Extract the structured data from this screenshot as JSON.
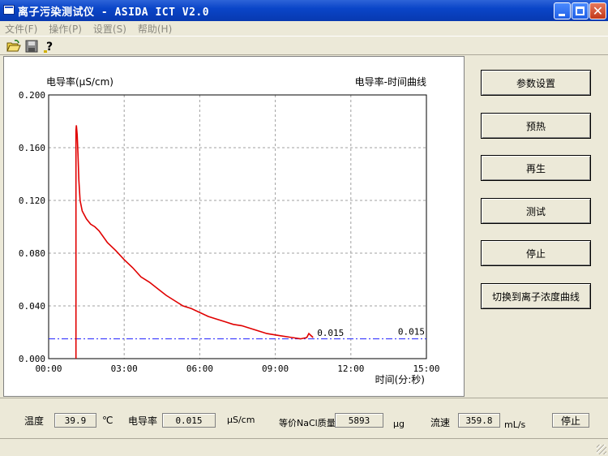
{
  "window": {
    "title": "离子污染测试仪 - ASIDA ICT V2.0"
  },
  "menu": [
    "文件(F)",
    "操作(P)",
    "设置(S)",
    "帮助(H)"
  ],
  "toolbar": {
    "icons": [
      "open-folder-icon",
      "save-icon",
      "help-icon"
    ]
  },
  "buttons": {
    "param_settings": "参数设置",
    "preheat": "预热",
    "regenerate": "再生",
    "test": "测试",
    "stop": "停止",
    "switch_curve": "切换到离子浓度曲线"
  },
  "status": {
    "temperature_label": "温度",
    "temperature_value": "39.9",
    "temperature_unit": "℃",
    "conductivity_label": "电导率",
    "conductivity_value": "0.015",
    "conductivity_unit": "μS/cm",
    "nacl_label": "等价NaCl质量",
    "nacl_value": "5893",
    "nacl_unit": "μg",
    "flow_label": "流速",
    "flow_value": "359.8",
    "flow_unit": "mL/s",
    "state_value": "停止"
  },
  "chart_data": {
    "type": "line",
    "title": "电导率-时间曲线",
    "ylabel": "电导率(μS/cm)",
    "xlabel": "时间(分:秒)",
    "xlim": [
      0,
      900
    ],
    "ylim": [
      0,
      0.2
    ],
    "x_ticks": [
      "00:00",
      "03:00",
      "06:00",
      "09:00",
      "12:00",
      "15:00"
    ],
    "y_ticks": [
      "0.000",
      "0.040",
      "0.080",
      "0.120",
      "0.160",
      "0.200"
    ],
    "grid": true,
    "colors": {
      "series": "#e00000",
      "threshold": "#2020ff"
    },
    "series": [
      {
        "x": [
          65,
          65,
          66,
          68,
          70,
          72,
          75,
          80,
          90,
          100,
          110,
          120,
          140,
          160,
          180,
          200,
          220,
          240,
          260,
          280,
          300,
          320,
          340,
          360,
          380,
          400,
          420,
          440,
          460,
          480,
          500,
          520,
          540,
          560,
          580,
          600,
          615,
          620,
          630
        ],
        "y": [
          0.0,
          0.173,
          0.177,
          0.17,
          0.155,
          0.135,
          0.12,
          0.112,
          0.106,
          0.102,
          0.1,
          0.097,
          0.088,
          0.082,
          0.075,
          0.069,
          0.062,
          0.058,
          0.053,
          0.048,
          0.044,
          0.04,
          0.038,
          0.035,
          0.032,
          0.03,
          0.028,
          0.026,
          0.025,
          0.023,
          0.021,
          0.019,
          0.018,
          0.017,
          0.016,
          0.015,
          0.016,
          0.019,
          0.016
        ]
      }
    ],
    "threshold": {
      "value": 0.015,
      "label": "0.015"
    },
    "end_label": "0.015"
  }
}
